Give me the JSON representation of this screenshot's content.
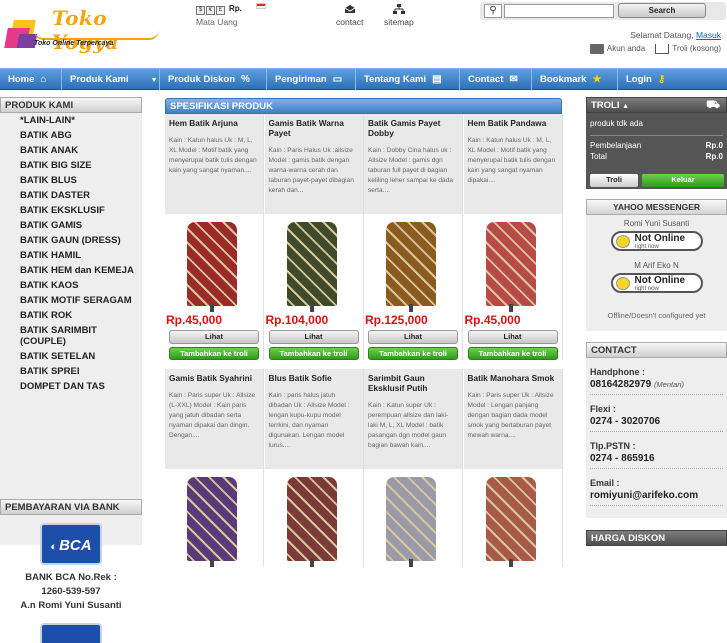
{
  "header": {
    "logo_title": "Toko Yogya",
    "logo_tagline": "Toko Online Terpercaya",
    "currency": {
      "label": "Mata Uang",
      "current": "Rp.",
      "buttons": [
        "$",
        "€",
        "£"
      ]
    },
    "links": [
      {
        "label": "contact",
        "icon": "envelope-icon"
      },
      {
        "label": "sitemap",
        "icon": "sitemap-icon"
      }
    ],
    "search": {
      "placeholder": "",
      "button": "Search"
    },
    "welcome": "Selamat Datang,",
    "login_link": "Masuk",
    "account_label": "Akun anda",
    "cart_label": "Troli (kosong)"
  },
  "nav": [
    {
      "label": "Home",
      "icon": "house-icon"
    },
    {
      "label": "Produk Kami",
      "icon": "dropdown-arrow-icon"
    },
    {
      "label": "Produk Diskon",
      "icon": "percent-icon"
    },
    {
      "label": "Pengiriman",
      "icon": "truck-icon"
    },
    {
      "label": "Tentang Kami",
      "icon": "info-icon"
    },
    {
      "label": "Contact",
      "icon": "envelope-icon"
    },
    {
      "label": "Bookmark",
      "icon": "star-icon"
    },
    {
      "label": "Login",
      "icon": "key-icon"
    }
  ],
  "categories": {
    "title": "PRODUK KAMI",
    "items": [
      "*LAIN-LAIN*",
      "BATIK ABG",
      "BATIK ANAK",
      "BATIK BIG SIZE",
      "BATIK BLUS",
      "BATIK DASTER",
      "BATIK EKSKLUSIF",
      "BATIK GAMIS",
      "BATIK GAUN (DRESS)",
      "BATIK HAMIL",
      "BATIK HEM dan KEMEJA",
      "BATIK KAOS",
      "BATIK MOTIF SERAGAM",
      "BATIK ROK",
      "BATIK SARIMBIT (COUPLE)",
      "BATIK SETELAN",
      "BATIK SPREI",
      "DOMPET DAN TAS"
    ]
  },
  "payment": {
    "title": "PEMBAYARAN VIA BANK",
    "bank_logo": "BCA",
    "lines": [
      "BANK BCA No.Rek :",
      "1260-539-597",
      "A.n Romi Yuni Susanti"
    ]
  },
  "main": {
    "title": "SPESIFIKASI PRODUK",
    "view_label": "Lihat",
    "add_label": "Tambahkan ke troli",
    "products": [
      {
        "name": "Hem Batik Arjuna",
        "desc": "Kain : Katun halus Uk : M, L, XL Model : Motif batik yang menyerupai batik tulis dengan kain yang sangat nyaman....",
        "price": "Rp.45,000",
        "color": "#9b2b2b"
      },
      {
        "name": "Gamis Batik Warna Payet",
        "desc": "Kain : Paris Halus Uk :allsize Model : gamis batik dengan warna-warna cerah dan taburan payet-payet dibagian kerah dan...",
        "price": "Rp.104,000",
        "color": "#3f4a2a"
      },
      {
        "name": "Batik Gamis Payet Dobby",
        "desc": "Kain : Dobby Cina halus uk : Allsize Model : gamis dgn taburan full payet di bagian keliling leher sampai ke dada serta....",
        "price": "Rp.125,000",
        "color": "#8a5a1e"
      },
      {
        "name": "Hem Batik Pandawa",
        "desc": "Kain : Katun halus Uk : M, L, XL Model : Motif batik yang menyerupai batik tulis dengan kain yang sangat nyaman dipakai....",
        "price": "Rp.45,000",
        "color": "#b84a4a"
      },
      {
        "name": "Gamis Batik Syahrini",
        "desc": "Kain : Paris super Uk : Allsize (L-XXL) Model : Kain paris yang jatuh dibadan serta nyaman dipakai dan dingin. Dengan....",
        "price": "",
        "color": "#5a3a7a"
      },
      {
        "name": "Blus Batik Sofie",
        "desc": "Kain : paris halus jatuh dibadan Uk : Allsize Model : lengan kupu-kupu model terrkini, dan nyaman digunakan. Lengan model lurus....",
        "price": "",
        "color": "#7a3a3a"
      },
      {
        "name": "Sarimbit Gaun Eksklusif Putih",
        "desc": "Kain : Katun super Uk : perempuan allsize dan laki-laki M, L, XL Model : batik pasangan dgn model gaun bagian bawah kain....",
        "price": "",
        "color": "#9a9aa8"
      },
      {
        "name": "Batik Manohara Smok",
        "desc": "Kain : Paris super Uk : Allsize Model : Lengan panjang dengan bagian dada model smok yang bertaburan payet mewah warna....",
        "price": "",
        "color": "#a85a4a"
      }
    ]
  },
  "cart": {
    "title": "TROLI",
    "empty": "produk tdk ada",
    "rows": [
      {
        "label": "Pembelanjaan",
        "value": "Rp.0"
      },
      {
        "label": "Total",
        "value": "Rp.0"
      }
    ],
    "view_button": "Troli",
    "checkout_button": "Keluar"
  },
  "messenger": {
    "title": "YAHOO MESSENGER",
    "contacts": [
      {
        "name": "Romi Yuni Susanti",
        "status": "Not Online",
        "sub": "right now"
      },
      {
        "name": "M Arif Eko N",
        "status": "Not Online",
        "sub": "right now"
      }
    ],
    "footer": "Offline/Doesn't configured yet"
  },
  "contact": {
    "title": "CONTACT",
    "entries": [
      {
        "label": "Handphone :",
        "value": "08164282979",
        "note": "(Mentari)"
      },
      {
        "label": "Flexi :",
        "value": "0274 - 3020706",
        "note": ""
      },
      {
        "label": "Tlp.PSTN :",
        "value": "0274 - 865916",
        "note": ""
      },
      {
        "label": "Email :",
        "value": "romiyuni@arifeko.com",
        "note": ""
      }
    ]
  },
  "discount": {
    "title": "HARGA DISKON"
  }
}
